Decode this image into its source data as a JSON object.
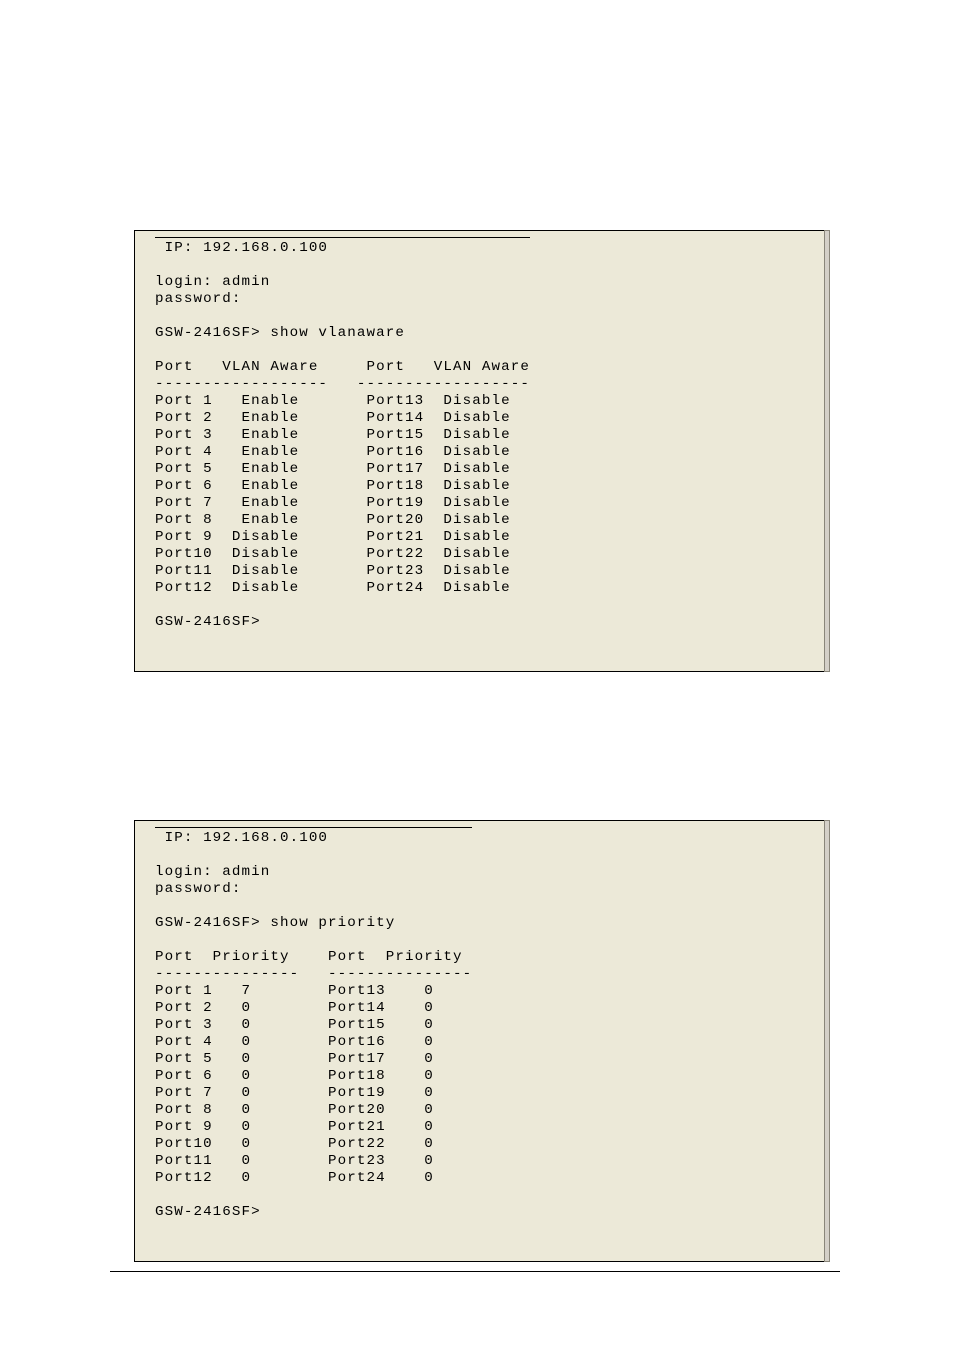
{
  "terminals": [
    {
      "ip_line": " IP: 192.168.0.100",
      "login_line": "login: admin",
      "password_line": "password:",
      "command_line": "GSW-2416SF> show vlanaware",
      "header_line": "Port   VLAN Aware     Port   VLAN Aware",
      "divider_line": "------------------   ------------------",
      "data_lines": [
        "Port 1   Enable       Port13  Disable",
        "Port 2   Enable       Port14  Disable",
        "Port 3   Enable       Port15  Disable",
        "Port 4   Enable       Port16  Disable",
        "Port 5   Enable       Port17  Disable",
        "Port 6   Enable       Port18  Disable",
        "Port 7   Enable       Port19  Disable",
        "Port 8   Enable       Port20  Disable",
        "Port 9  Disable       Port21  Disable",
        "Port10  Disable       Port22  Disable",
        "Port11  Disable       Port23  Disable",
        "Port12  Disable       Port24  Disable"
      ],
      "prompt_line": "GSW-2416SF>"
    },
    {
      "ip_line": " IP: 192.168.0.100",
      "login_line": "login: admin",
      "password_line": "password:",
      "command_line": "GSW-2416SF> show priority",
      "header_line": "Port  Priority    Port  Priority",
      "divider_line": "---------------   ---------------",
      "data_lines": [
        "Port 1   7        Port13    0",
        "Port 2   0        Port14    0",
        "Port 3   0        Port15    0",
        "Port 4   0        Port16    0",
        "Port 5   0        Port17    0",
        "Port 6   0        Port18    0",
        "Port 7   0        Port19    0",
        "Port 8   0        Port20    0",
        "Port 9   0        Port21    0",
        "Port10   0        Port22    0",
        "Port11   0        Port23    0",
        "Port12   0        Port24    0"
      ],
      "prompt_line": "GSW-2416SF>"
    }
  ]
}
